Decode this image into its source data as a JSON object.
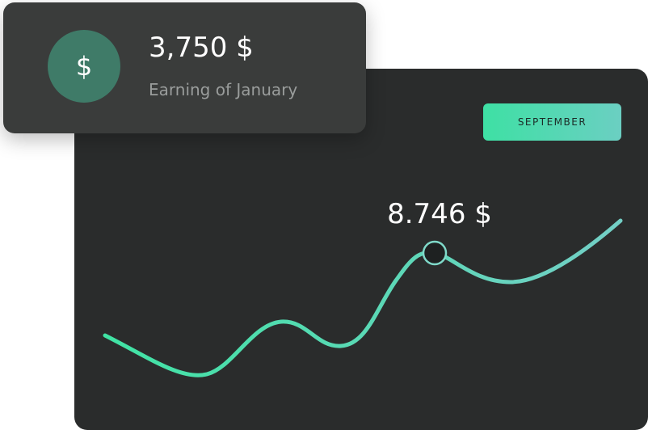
{
  "earning_card": {
    "icon": "dollar-icon",
    "icon_glyph": "$",
    "amount": "3,750 $",
    "caption": "Earning of January"
  },
  "chart_card": {
    "month_button_label": "SEPTEMBER",
    "highlight_label": "8.746 $",
    "line_gradient": [
      "#40e3a4",
      "#73cfc6"
    ]
  },
  "colors": {
    "accent_green": "#40e3a4",
    "accent_teal": "#73cfc6",
    "card_dark": "#2a2c2c",
    "card_gray": "#3a3c3b",
    "badge_green": "#3f7b68"
  }
}
